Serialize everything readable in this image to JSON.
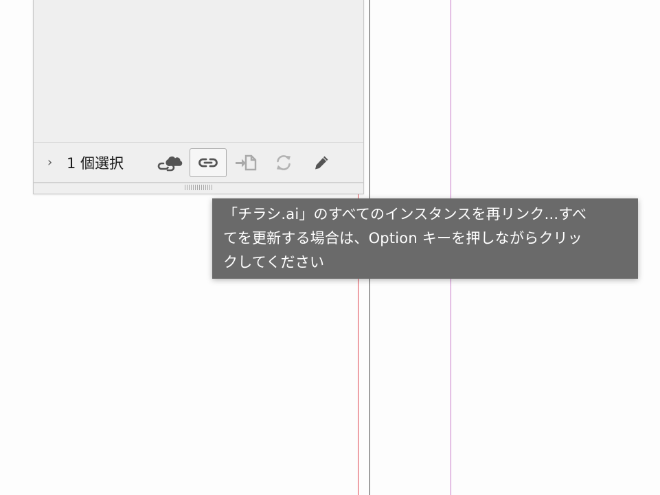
{
  "panel": {
    "expand_glyph": "›",
    "selection_status": "1 個選択",
    "icons": {
      "cloud": "cloud-link-icon",
      "relink": "relink-icon",
      "goto": "go-to-link-icon",
      "update": "update-link-icon",
      "edit": "edit-original-icon"
    }
  },
  "tooltip": {
    "lines": [
      "「チラシ.ai」のすべてのインスタンスを再リンク...すべ",
      "てを更新する場合は、Option キーを押しながらクリッ",
      "クしてください"
    ]
  },
  "colors": {
    "panel_bg": "#efefef",
    "tooltip_bg": "#6a6a6a",
    "guide_red": "#e0454f",
    "guide_magenta": "#c979c9"
  }
}
